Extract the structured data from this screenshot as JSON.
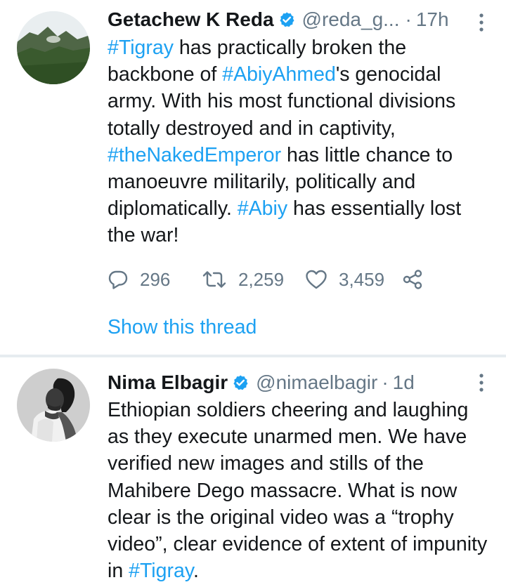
{
  "tweets": [
    {
      "author": {
        "name": "Getachew K Reda",
        "handle": "@reda_g...",
        "verified": true,
        "avatar": "landscape-photo"
      },
      "separator": "·",
      "time": "17h",
      "text": [
        {
          "t": "#Tigray",
          "hashtag": true
        },
        {
          "t": " has practically  broken the backbone of ",
          "hashtag": false
        },
        {
          "t": "#AbiyAhmed",
          "hashtag": true
        },
        {
          "t": "'s genocidal army. With his most functional divisions totally destroyed and in captivity, ",
          "hashtag": false
        },
        {
          "t": "#theNakedEmperor",
          "hashtag": true
        },
        {
          "t": " has little chance to manoeuvre militarily, politically and diplomatically. ",
          "hashtag": false
        },
        {
          "t": "#Abiy",
          "hashtag": true
        },
        {
          "t": " has essentially lost the war!",
          "hashtag": false
        }
      ],
      "actions": {
        "replies": "296",
        "retweets": "2,259",
        "likes": "3,459"
      },
      "show_thread": "Show this thread"
    },
    {
      "author": {
        "name": "Nima Elbagir",
        "handle": "@nimaelbagir",
        "verified": true,
        "avatar": "portrait-photo"
      },
      "separator": "·",
      "time": "1d",
      "text": [
        {
          "t": "Ethiopian soldiers cheering and laughing as they execute unarmed men. We have verified new images and stills of the Mahibere Dego massacre. What is now clear is the original video was a “trophy video”, clear evidence of extent of impunity in ",
          "hashtag": false
        },
        {
          "t": "#Tigray",
          "hashtag": true
        },
        {
          "t": ".",
          "hashtag": false
        }
      ]
    }
  ],
  "icons": {
    "verified": "verified-badge-icon",
    "more": "more-vertical-icon",
    "reply": "reply-icon",
    "retweet": "retweet-icon",
    "like": "heart-icon",
    "share": "share-icon"
  },
  "colors": {
    "link": "#1da1f2",
    "text": "#14171a",
    "secondary": "#657786",
    "divider": "#e6ecf0"
  }
}
